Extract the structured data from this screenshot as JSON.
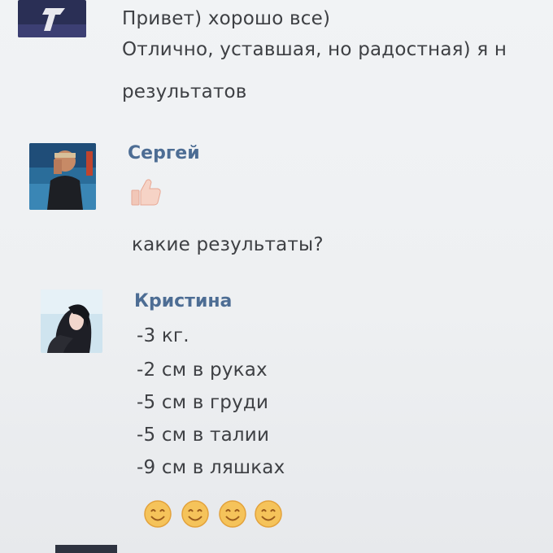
{
  "conversation": {
    "messages_top": [
      "Привет) хорошо все)",
      "Отлично, уставшая, но радостная) я н",
      "результатов"
    ],
    "sergey": {
      "name": "Сергей",
      "reaction_icon": "thumbs-up-icon",
      "question": "какие результаты?"
    },
    "kristina": {
      "name": "Кристина",
      "lines": [
        "-3 кг.",
        "-2 см в руках",
        "-5 см в груди",
        "-5 см в талии",
        "-9 см в ляшках"
      ],
      "emoji_icons": [
        "smiley-icon",
        "smiley-icon",
        "smiley-icon",
        "smiley-icon"
      ]
    }
  },
  "colors": {
    "name_link": "#4d6d94",
    "text": "#3e4044",
    "background": "#eef0f2",
    "smiley": "#f3b94a"
  }
}
